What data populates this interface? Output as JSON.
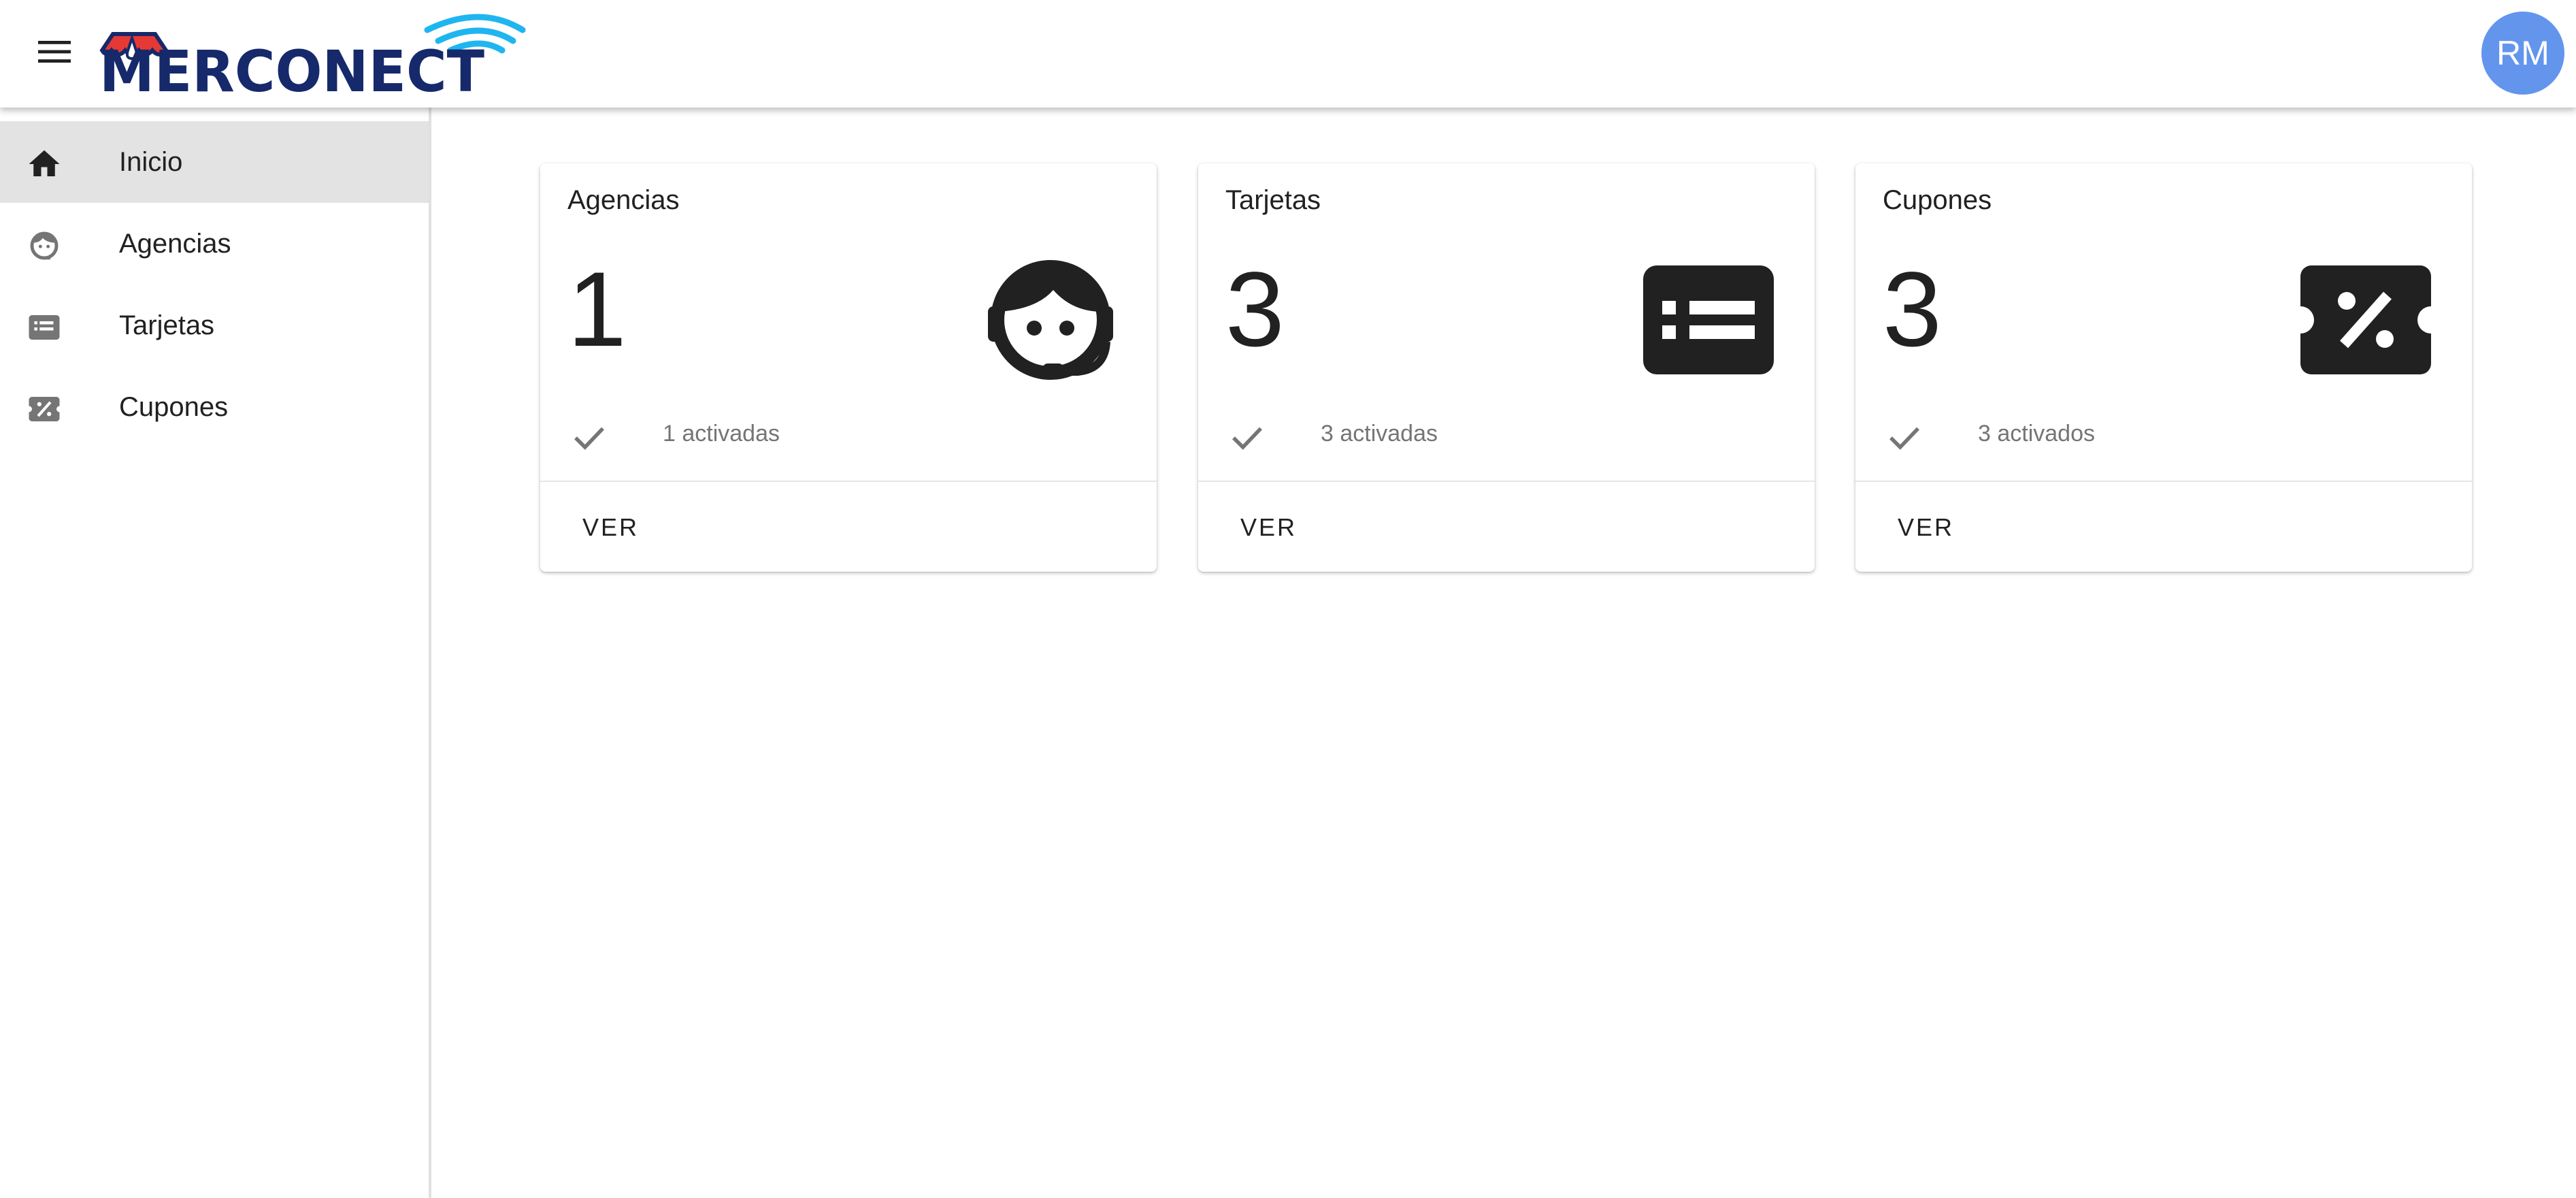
{
  "header": {
    "menu_icon": "menu-icon",
    "logo_text": "MERCONECT",
    "logo_colors": {
      "text": "#16296b",
      "awning_red": "#e53935",
      "wifi": "#1fb6f0"
    },
    "avatar_initials": "RM",
    "avatar_color": "#6495ed"
  },
  "sidebar": {
    "items": [
      {
        "label": "Inicio",
        "icon": "home-icon",
        "active": true
      },
      {
        "label": "Agencias",
        "icon": "support-agent-icon",
        "active": false
      },
      {
        "label": "Tarjetas",
        "icon": "card-list-icon",
        "active": false
      },
      {
        "label": "Cupones",
        "icon": "coupon-icon",
        "active": false
      }
    ]
  },
  "cards": [
    {
      "title": "Agencias",
      "count": "1",
      "status": "1 activadas",
      "action": "VER",
      "icon": "support-agent-icon",
      "status_icon": "check-icon"
    },
    {
      "title": "Tarjetas",
      "count": "3",
      "status": "3 activadas",
      "action": "VER",
      "icon": "card-list-icon",
      "status_icon": "check-icon"
    },
    {
      "title": "Cupones",
      "count": "3",
      "status": "3 activados",
      "action": "VER",
      "icon": "coupon-icon",
      "status_icon": "check-icon"
    }
  ]
}
